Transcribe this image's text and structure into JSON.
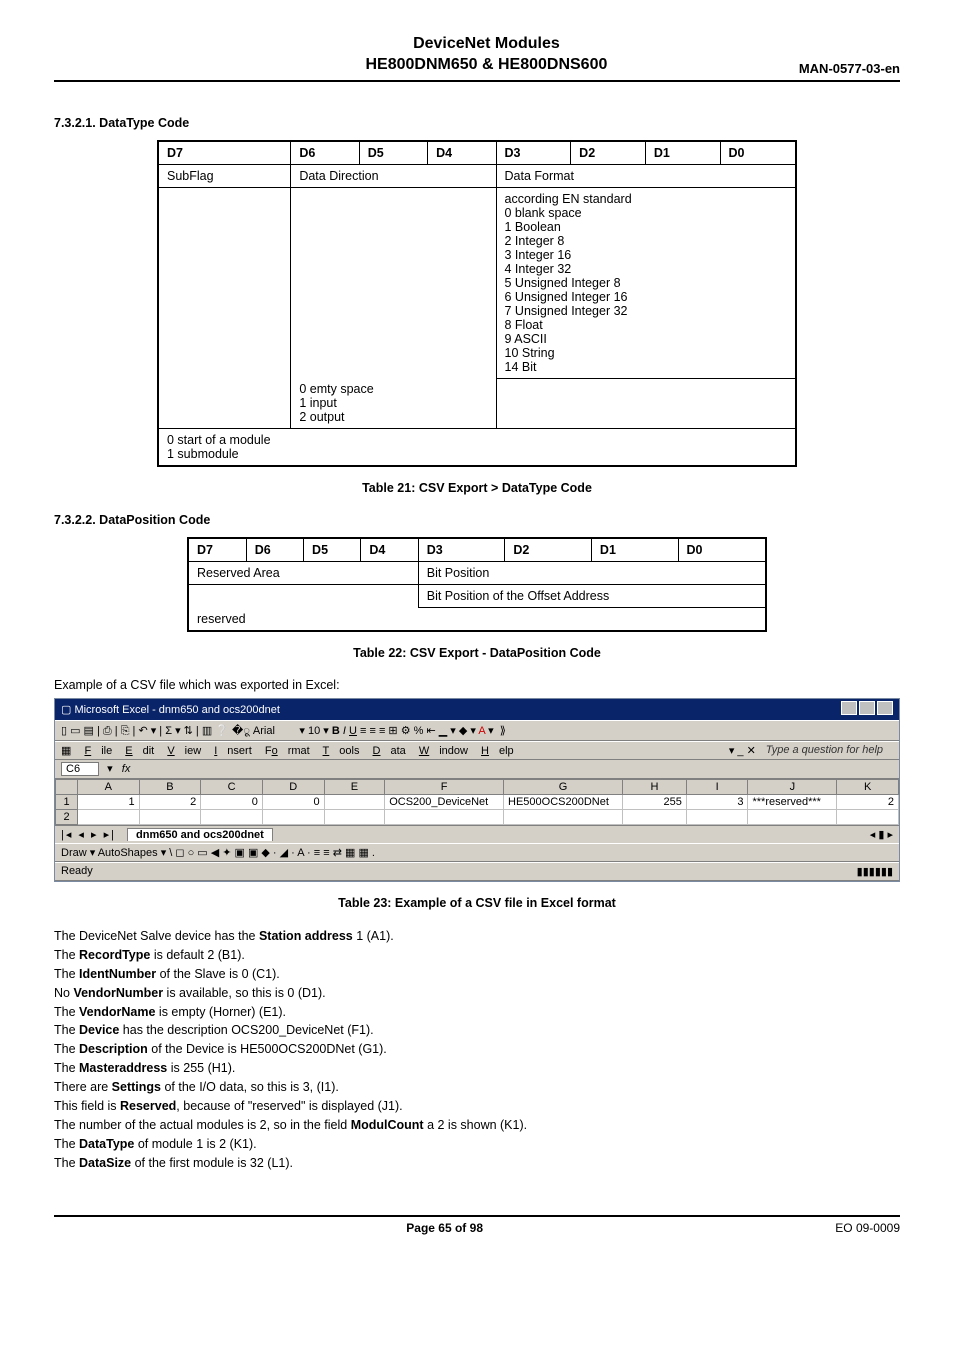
{
  "header": {
    "title_l1": "DeviceNet Modules",
    "title_l2": "HE800DNM650 & HE800DNS600",
    "right": "MAN-0577-03-en"
  },
  "sec7321": {
    "title": "7.3.2.1. DataType Code",
    "cols": [
      "D7",
      "D6",
      "D5",
      "D4",
      "D3",
      "D2",
      "D1",
      "D0"
    ],
    "row2": {
      "c1": "SubFlag",
      "c2": "Data Direction",
      "c3": "Data Format"
    },
    "dataformat": "according EN standard\n0 blank space\n1 Boolean\n2 Integer 8\n3 Integer 16\n4 Integer 32\n5 Unsigned Integer 8\n6 Unsigned Integer 16\n7 Unsigned Integer 32\n8 Float\n9 ASCII\n10 String\n14 Bit",
    "datadir": "0 emty space\n1 input\n2 output",
    "subflag": "0 start of a module\n1 submodule",
    "caption": "Table 21: CSV Export > DataType Code"
  },
  "sec7322": {
    "title": "7.3.2.2. DataPosition Code",
    "cols": [
      "D7",
      "D6",
      "D5",
      "D4",
      "D3",
      "D2",
      "D1",
      "D0"
    ],
    "row2": {
      "c1": "Reserved Area",
      "c2": "Bit Position"
    },
    "row3": {
      "c1": "reserved",
      "c2": "Bit Position of the Offset Address"
    },
    "caption": "Table 22: CSV Export - DataPosition Code"
  },
  "csv_intro": "Example of a CSV file which was exported in Excel:",
  "excel": {
    "title": "Microsoft Excel - dnm650 and ocs200dnet",
    "menus": [
      "File",
      "Edit",
      "View",
      "Insert",
      "Format",
      "Tools",
      "Data",
      "Window",
      "Help"
    ],
    "help_prompt": "Type a question for help",
    "toolbar_font": "Arial",
    "toolbar_size": "10",
    "namebox": "C6",
    "fx_label": "fx",
    "col_heads": [
      "A",
      "B",
      "C",
      "D",
      "E",
      "F",
      "G",
      "H",
      "I",
      "J",
      "K"
    ],
    "rows": [
      {
        "n": "1",
        "cells": [
          "1",
          "2",
          "0",
          "0",
          "",
          "OCS200_DeviceNet",
          "HE500OCS200DNet",
          "255",
          "3",
          "***reserved***",
          "2"
        ]
      },
      {
        "n": "2",
        "cells": [
          "",
          "",
          "",
          "",
          "",
          "",
          "",
          "",
          "",
          "",
          ""
        ]
      }
    ],
    "sheet_tab": "dnm650 and ocs200dnet",
    "drawbar": "Draw ▾   AutoShapes ▾  \\  ◻  ○  ▭  ◀  ✦  ▣  ▣   ◆ · ◢ · A · ≡ ≡ ⇄ ▦ ▦ .",
    "status": "Ready"
  },
  "caption23": "Table 23: Example of a CSV file in Excel format",
  "notes": [
    [
      "The DeviceNet Salve device has the ",
      "Station address",
      " 1 (A1)."
    ],
    [
      "The ",
      "RecordType",
      " is default 2 (B1)."
    ],
    [
      "The ",
      "IdentNumber",
      " of the Slave is 0 (C1)."
    ],
    [
      "No ",
      "VendorNumber",
      " is available, so this is 0 (D1)."
    ],
    [
      "The ",
      "VendorName",
      " is empty (Horner) (E1)."
    ],
    [
      "The ",
      "Device",
      " has the description OCS200_DeviceNet (F1)."
    ],
    [
      "The ",
      "Description",
      " of the Device is HE500OCS200DNet (G1)."
    ],
    [
      "The ",
      "Masteraddress",
      " is 255 (H1)."
    ],
    [
      "There are ",
      "Settings",
      " of the I/O data, so this is 3, (I1)."
    ],
    [
      "This field is ",
      "Reserved",
      ", because of \"reserved\" is displayed (J1)."
    ],
    [
      "The number of the actual modules is 2, so in the field ",
      "ModulCount",
      " a 2 is shown (K1)."
    ],
    [
      "The ",
      "DataType",
      " of module 1 is 2 (K1)."
    ],
    [
      "The ",
      "DataSize",
      " of the first module is 32 (L1)."
    ]
  ],
  "footer": {
    "left": "",
    "mid": "Page 65 of 98",
    "right": "EO 09-0009"
  }
}
